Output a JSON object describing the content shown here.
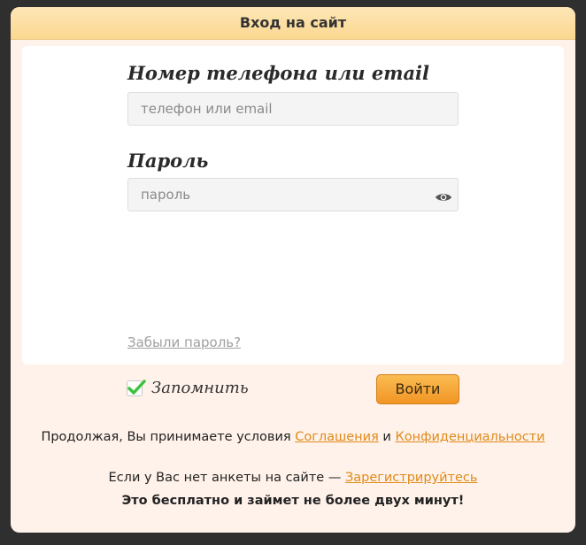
{
  "modal": {
    "title": "Вход на сайт"
  },
  "login_field": {
    "label": "Номер телефона или email",
    "placeholder": "телефон или email",
    "value": ""
  },
  "password_field": {
    "label": "Пароль",
    "placeholder": "пароль",
    "value": "",
    "toggle_icon": "eye-icon"
  },
  "forgot_password": {
    "label": "Забыли пароль?"
  },
  "remember": {
    "label": "Запомнить",
    "checked": true,
    "check_color": "#3cc33c"
  },
  "login_button": {
    "label": "Войти",
    "color": "#f5a83a"
  },
  "terms": {
    "prefix": "Продолжая, Вы принимаете условия ",
    "agreement_link": "Соглашения",
    "conjunction": " и ",
    "privacy_link": "Конфиденциальности",
    "link_color": "#e08a1a"
  },
  "register": {
    "prefix": "Если у Вас нет анкеты на сайте — ",
    "link": "Зарегистрируйтесь",
    "note": "Это бесплатно и займет не более двух минут!"
  }
}
